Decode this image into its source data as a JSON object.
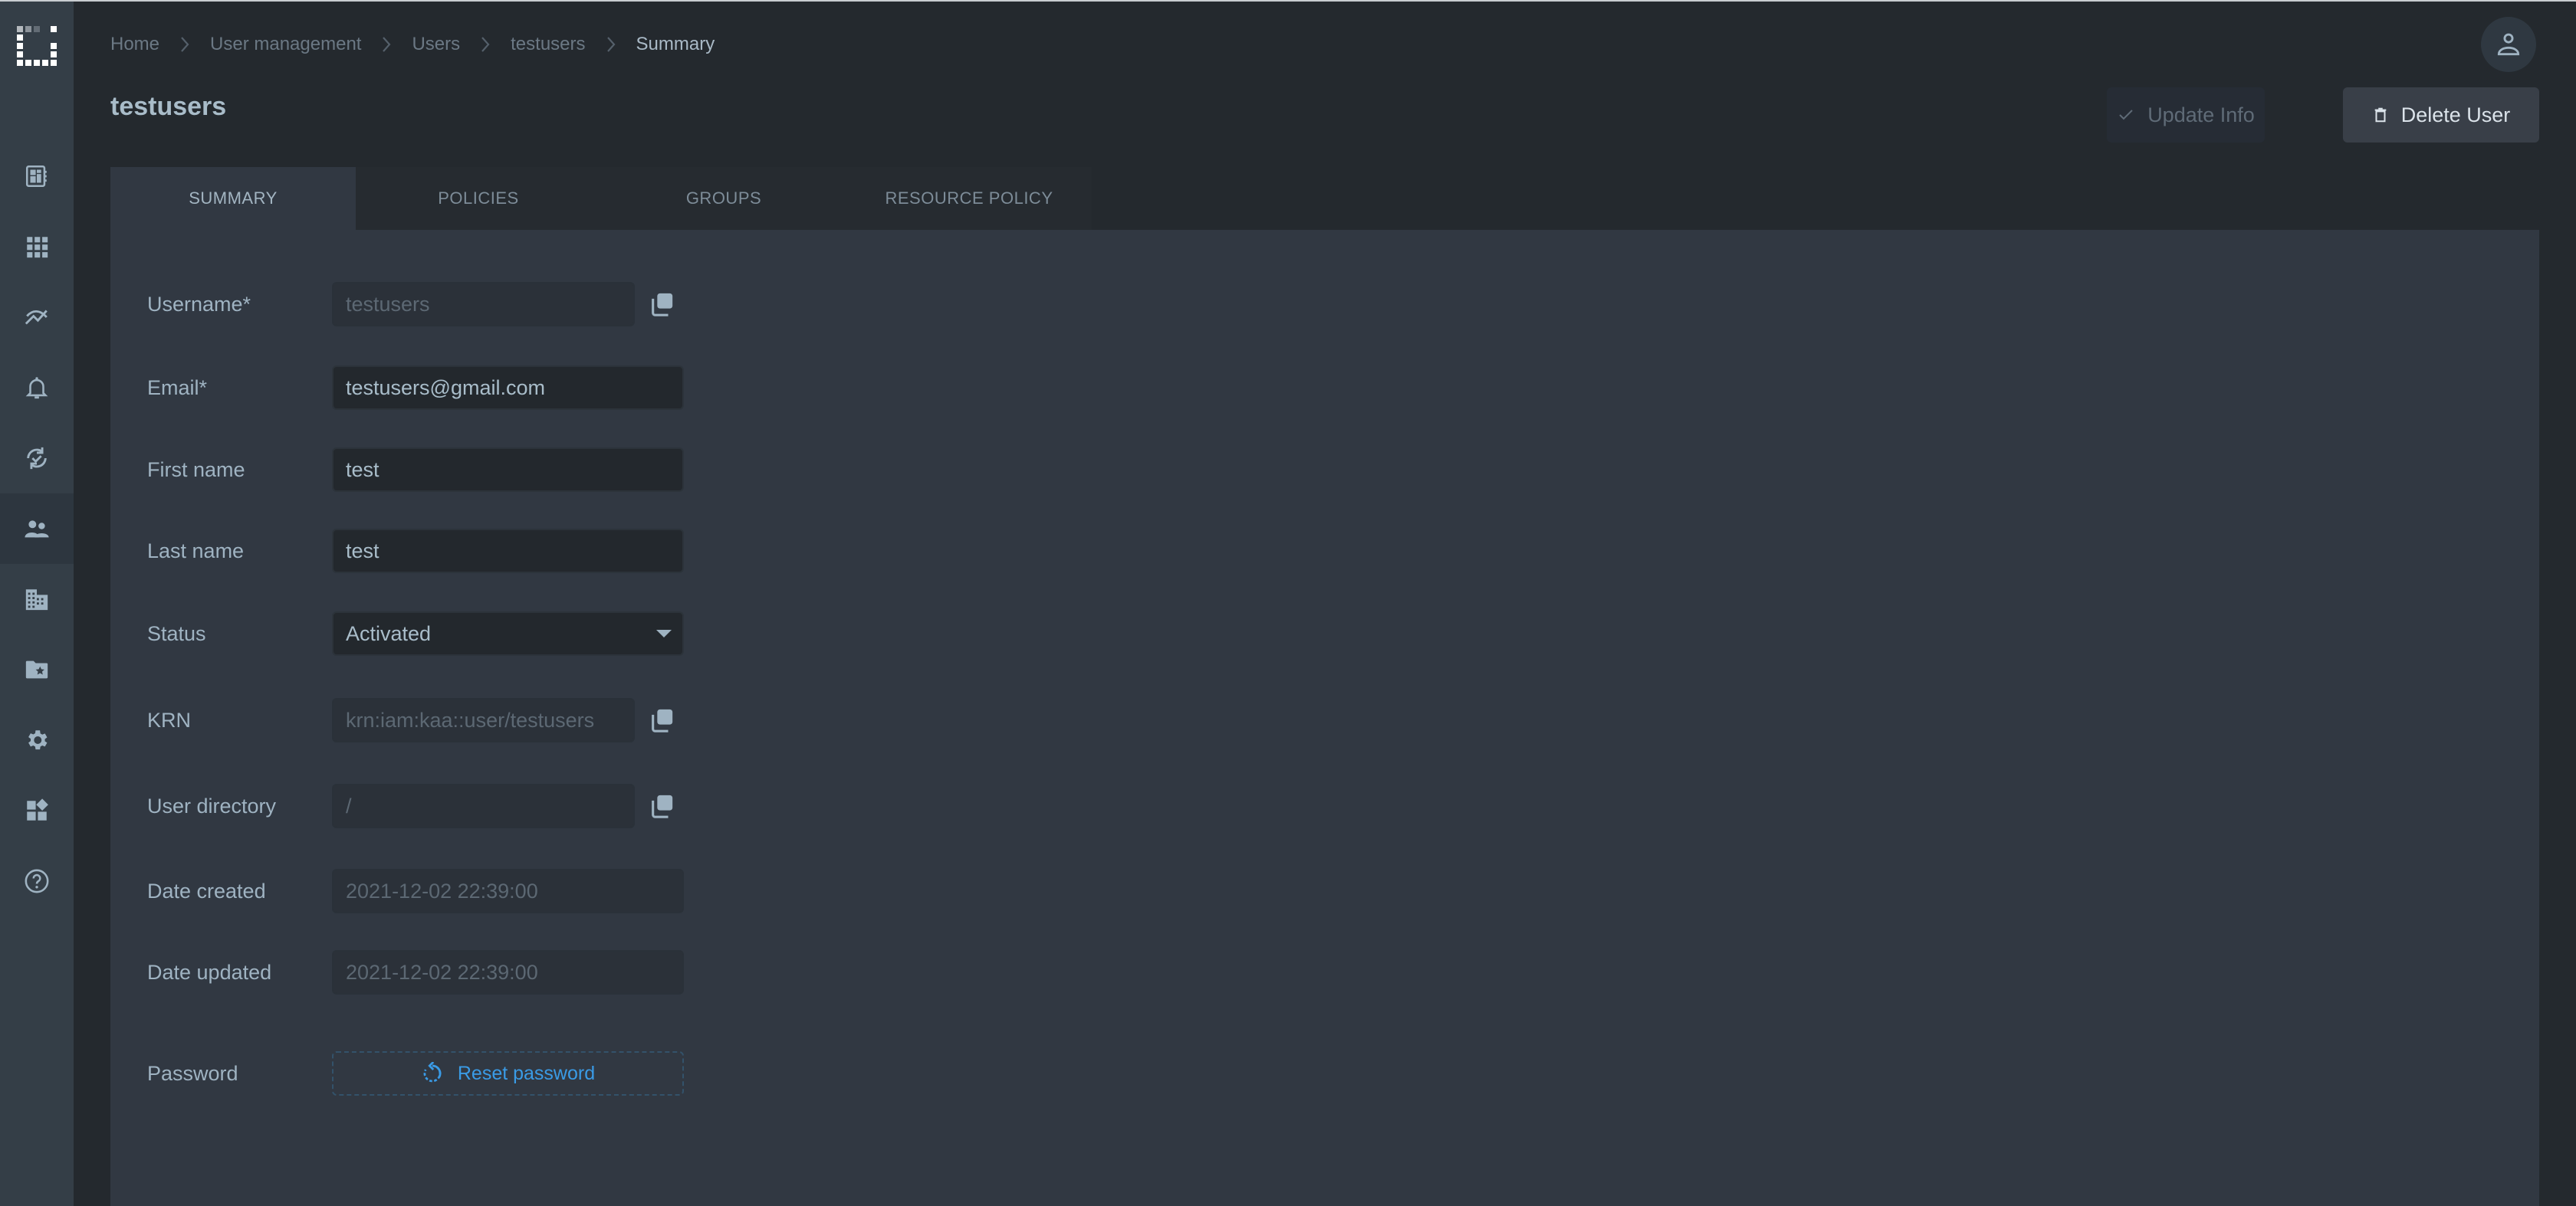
{
  "breadcrumb": [
    {
      "label": "Home"
    },
    {
      "label": "User management"
    },
    {
      "label": "Users"
    },
    {
      "label": "testusers"
    },
    {
      "label": "Summary"
    }
  ],
  "header": {
    "title": "testusers",
    "update_label": "Update Info",
    "delete_label": "Delete User"
  },
  "sidebar": {
    "items": [
      {
        "icon": "dashboard-icon",
        "label": "Dashboards"
      },
      {
        "icon": "apps-grid-icon",
        "label": "Applications"
      },
      {
        "icon": "analytics-icon",
        "label": "Analytics"
      },
      {
        "icon": "bell-icon",
        "label": "Alerts"
      },
      {
        "icon": "sync-check-icon",
        "label": "Workflows"
      },
      {
        "icon": "users-icon",
        "label": "User management",
        "active": true
      },
      {
        "icon": "building-icon",
        "label": "Tenants"
      },
      {
        "icon": "folder-star-icon",
        "label": "Resources"
      },
      {
        "icon": "gear-icon",
        "label": "Settings"
      },
      {
        "icon": "widgets-icon",
        "label": "Widgets"
      },
      {
        "icon": "help-icon",
        "label": "Help"
      }
    ]
  },
  "tabs": [
    {
      "label": "SUMMARY",
      "active": true
    },
    {
      "label": "POLICIES"
    },
    {
      "label": "GROUPS"
    },
    {
      "label": "RESOURCE POLICY"
    }
  ],
  "form": {
    "username": {
      "label": "Username*",
      "value": "testusers"
    },
    "email": {
      "label": "Email*",
      "value": "testusers@gmail.com"
    },
    "first_name": {
      "label": "First name",
      "value": "test"
    },
    "last_name": {
      "label": "Last name",
      "value": "test"
    },
    "status": {
      "label": "Status",
      "value": "Activated"
    },
    "krn": {
      "label": "KRN",
      "value": "krn:iam:kaa::user/testusers"
    },
    "user_directory": {
      "label": "User directory",
      "value": "/"
    },
    "date_created": {
      "label": "Date created",
      "value": "2021-12-02 22:39:00"
    },
    "date_updated": {
      "label": "Date updated",
      "value": "2021-12-02 22:39:00"
    },
    "password": {
      "label": "Password",
      "reset_label": "Reset password"
    }
  },
  "colors": {
    "accent": "#3a9be6",
    "sidebar_bg": "#343e47",
    "page_bg": "#24292e",
    "panel_bg": "#313842"
  }
}
